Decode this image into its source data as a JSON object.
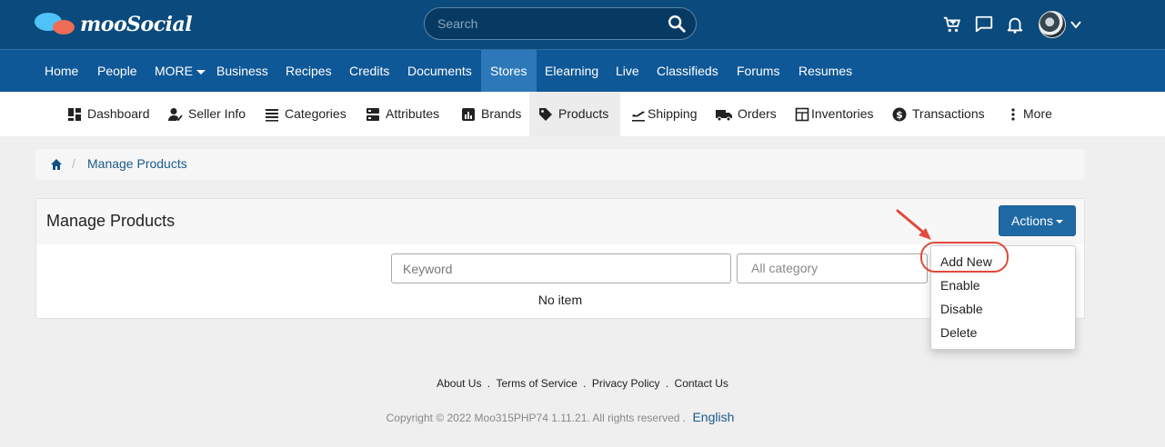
{
  "header": {
    "brand": "mooSocial",
    "search_placeholder": "Search"
  },
  "main_nav": {
    "items": [
      {
        "label": "Home"
      },
      {
        "label": "People"
      },
      {
        "label": "MORE"
      },
      {
        "label": "Business"
      },
      {
        "label": "Recipes"
      },
      {
        "label": "Credits"
      },
      {
        "label": "Documents"
      },
      {
        "label": "Stores",
        "active": true
      },
      {
        "label": "Elearning"
      },
      {
        "label": "Live"
      },
      {
        "label": "Classifieds"
      },
      {
        "label": "Forums"
      },
      {
        "label": "Resumes"
      }
    ]
  },
  "sub_nav": {
    "items": [
      {
        "label": "Dashboard",
        "icon": "dashboard-icon"
      },
      {
        "label": "Seller Info",
        "icon": "seller-icon"
      },
      {
        "label": "Categories",
        "icon": "list-icon"
      },
      {
        "label": "Attributes",
        "icon": "attributes-icon"
      },
      {
        "label": "Brands",
        "icon": "chart-icon"
      },
      {
        "label": "Products",
        "icon": "tag-icon",
        "active": true
      },
      {
        "label": "Shipping",
        "icon": "plane-icon"
      },
      {
        "label": "Orders",
        "icon": "truck-icon"
      },
      {
        "label": "Inventories",
        "icon": "inventory-icon"
      },
      {
        "label": "Transactions",
        "icon": "dollar-icon"
      },
      {
        "label": "More",
        "icon": "more-vertical-icon"
      }
    ]
  },
  "breadcrumb": {
    "current": "Manage Products"
  },
  "panel": {
    "title": "Manage Products",
    "actions_label": "Actions",
    "keyword_placeholder": "Keyword",
    "category_value": "All category",
    "empty_text": "No item"
  },
  "actions_menu": {
    "items": [
      "Add New",
      "Enable",
      "Disable",
      "Delete"
    ]
  },
  "footer": {
    "links": [
      "About Us",
      "Terms of Service",
      "Privacy Policy",
      "Contact Us"
    ],
    "copyright": "Copyright © 2022 Moo315PHP74 1.11.21. All rights reserved",
    "language": "English"
  },
  "colors": {
    "header_bg": "#0a4a7c",
    "nav_bg": "#0f5897",
    "nav_active": "#2d78b9",
    "primary_button": "#1f6aa5",
    "annotation_red": "#e04a3c"
  }
}
